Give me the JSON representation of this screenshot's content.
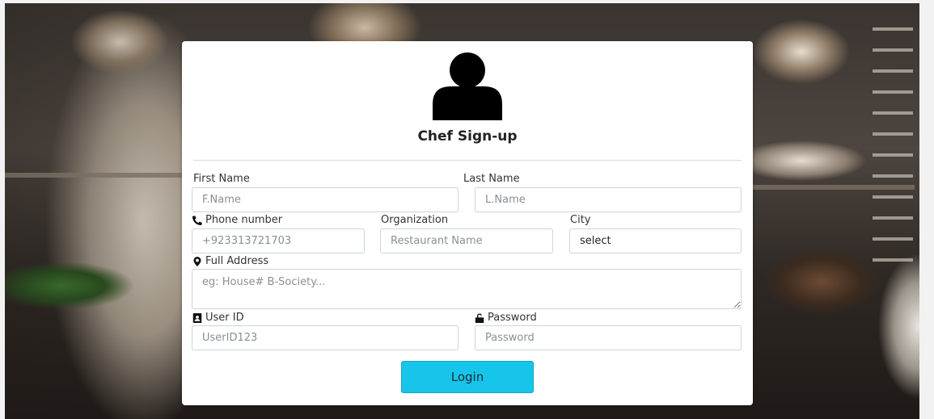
{
  "form": {
    "title": "Chef Sign-up",
    "first_name": {
      "label": "First Name",
      "placeholder": "F.Name",
      "value": ""
    },
    "last_name": {
      "label": "Last Name",
      "placeholder": "L.Name",
      "value": ""
    },
    "phone": {
      "label": "Phone number",
      "placeholder": "+923313721703",
      "icon": "phone-icon"
    },
    "organization": {
      "label": "Organization",
      "placeholder": "Restaurant Name"
    },
    "city": {
      "label": "City",
      "selected": "select"
    },
    "address": {
      "label": "Full Address",
      "placeholder": "eg: House# B-Society...",
      "icon": "map-marker-icon"
    },
    "user_id": {
      "label": "User ID",
      "placeholder": "UserID123",
      "icon": "id-card-icon"
    },
    "password": {
      "label": "Password",
      "placeholder": "Password",
      "icon": "unlock-icon"
    },
    "submit_label": "Login"
  },
  "colors": {
    "button": "#17c4ea",
    "card": "#ffffff"
  }
}
